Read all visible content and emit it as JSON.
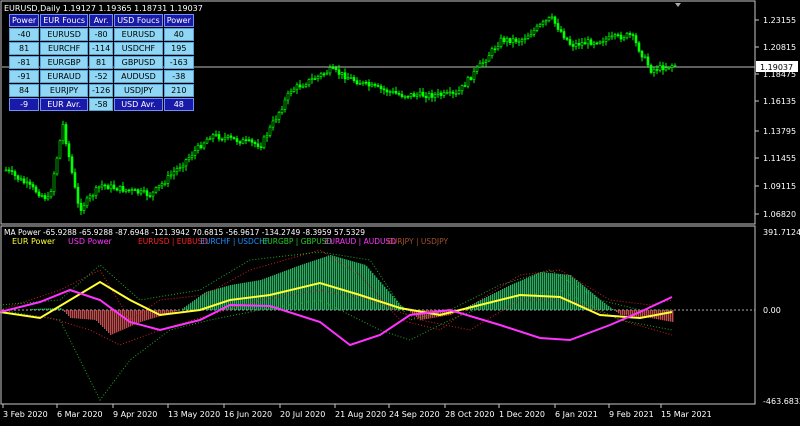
{
  "window": {
    "title": "EURUSD,Daily",
    "ohlc": "1.19127 1.19365 1.18731 1.19037",
    "current_price": "1.19037"
  },
  "price_axis": {
    "labels": [
      "1.23155",
      "1.20815",
      "1.18475",
      "1.16135",
      "1.13795",
      "1.11455",
      "1.09115",
      "1.06820"
    ]
  },
  "indicator": {
    "header": "MA Power -65.9288 -65.9288 -87.6948 -121.3942 70.6815 -56.9617 -134.2749 -8.3959 57.5329",
    "legend": [
      {
        "text": "EUR Power",
        "color": "#ffff33"
      },
      {
        "text": "USD Power",
        "color": "#ff33ff"
      },
      {
        "text": "EURUSD | EUBUSD",
        "color": "#ff2020"
      },
      {
        "text": "EURCHF | USDCHF",
        "color": "#1e90ff"
      },
      {
        "text": "EURGBP | GBPUSD",
        "color": "#22cc22"
      },
      {
        "text": "EURAUD | AUDUSD",
        "color": "#ff33ff"
      },
      {
        "text": "EURJPY | USDJPY",
        "color": "#a0522d"
      }
    ],
    "axis": {
      "top": "391.7124",
      "zero": "0.00",
      "bottom": "-463.6832"
    }
  },
  "time_axis": {
    "labels": [
      "3 Feb 2020",
      "6 Mar 2020",
      "9 Apr 2020",
      "13 May 2020",
      "16 Jun 2020",
      "20 Jul 2020",
      "21 Aug 2020",
      "24 Sep 2020",
      "28 Oct 2020",
      "1 Dec 2020",
      "6 Jan 2021",
      "9 Feb 2021",
      "15 Mar 2021"
    ]
  },
  "panel": {
    "headers": [
      "Power",
      "EUR Foucs",
      "Avr.",
      "USD Foucs",
      "Power"
    ],
    "rows": [
      [
        "-40",
        "EURUSD",
        "-80",
        "EURUSD",
        "40"
      ],
      [
        "81",
        "EURCHF",
        "-114",
        "USDCHF",
        "195"
      ],
      [
        "-81",
        "EURGBP",
        "81",
        "GBPUSD",
        "-163"
      ],
      [
        "-91",
        "EURAUD",
        "-52",
        "AUDUSD",
        "-38"
      ],
      [
        "84",
        "EURJPY",
        "-126",
        "USDJPY",
        "210"
      ]
    ],
    "summary": [
      "-9",
      "EUR Avr.",
      "-58",
      "USD Avr.",
      "48"
    ]
  },
  "chart_data": {
    "type": "line",
    "price_series": {
      "x": [
        "3 Feb 2020",
        "6 Mar 2020",
        "9 Apr 2020",
        "13 May 2020",
        "16 Jun 2020",
        "20 Jul 2020",
        "21 Aug 2020",
        "24 Sep 2020",
        "28 Oct 2020",
        "1 Dec 2020",
        "6 Jan 2021",
        "9 Feb 2021",
        "15 Mar 2021"
      ],
      "close": [
        1.1,
        1.12,
        1.082,
        1.09,
        1.13,
        1.175,
        1.185,
        1.168,
        1.172,
        1.205,
        1.225,
        1.21,
        1.19
      ],
      "ylim": [
        1.0682,
        1.25
      ]
    },
    "indicator_series": [
      {
        "name": "EUR Power",
        "values": [
          -20,
          -40,
          30,
          -5,
          30,
          50,
          55,
          -10,
          -10,
          40,
          60,
          -30,
          0
        ]
      },
      {
        "name": "USD Power",
        "values": [
          0,
          20,
          -60,
          0,
          -15,
          20,
          -10,
          -100,
          20,
          -80,
          -150,
          -20,
          60
        ]
      }
    ],
    "indicator_ylim": [
      -463.6832,
      391.7124
    ]
  },
  "colors": {
    "bg": "#000000",
    "candle": "#00ff00",
    "grid": "#ffffff",
    "zero": "#aaaaaa",
    "eur": "#ffff33",
    "usd": "#ff33ff",
    "hist_pos": "#2ecc71",
    "hist_neg": "#e05a5a"
  }
}
